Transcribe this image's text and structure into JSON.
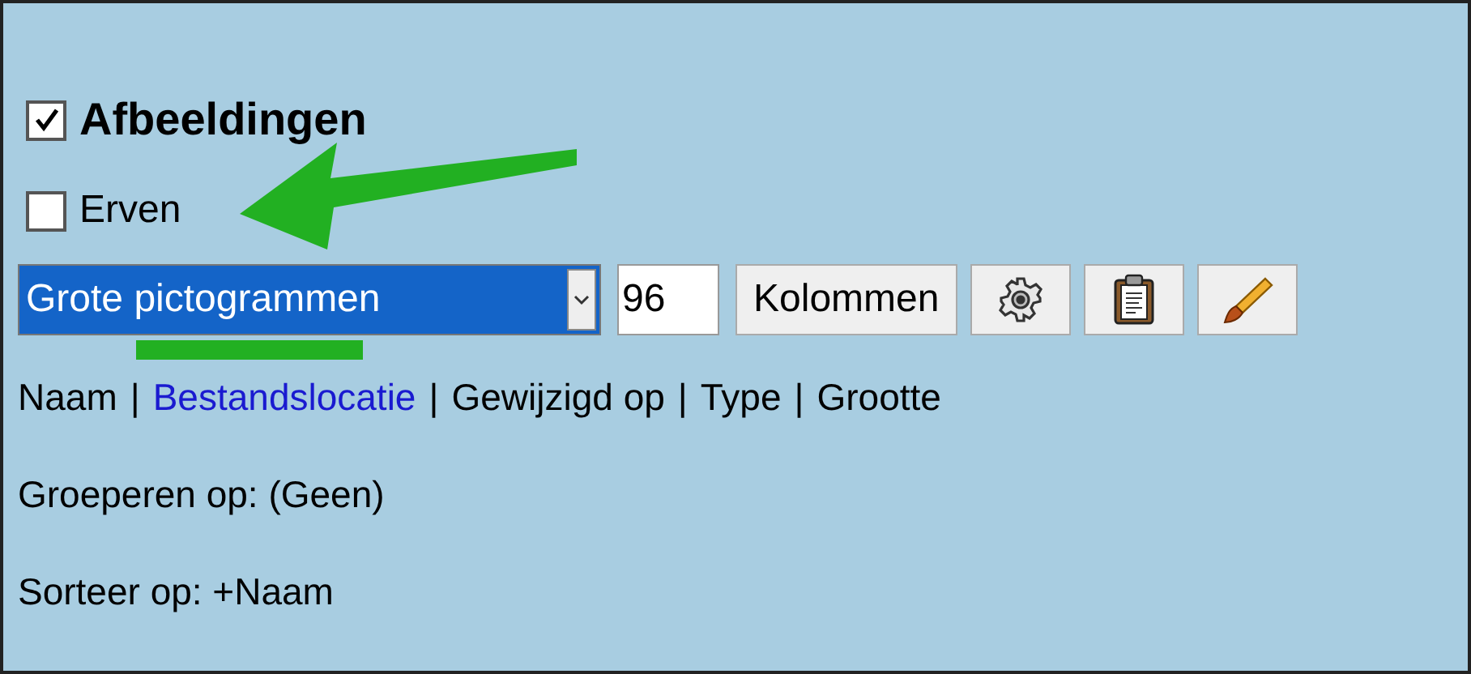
{
  "header": {
    "label": "Afbeeldingen",
    "checked": true
  },
  "inherit": {
    "label": "Erven",
    "checked": false
  },
  "toolbar": {
    "view_select": {
      "value": "Grote pictogrammen"
    },
    "size_field": {
      "value": "96"
    },
    "columns_button": "Kolommen"
  },
  "columns_line": [
    {
      "kind": "column",
      "text": "Naam",
      "selected": false
    },
    {
      "kind": "separator",
      "text": "|"
    },
    {
      "kind": "column",
      "text": "Bestandslocatie",
      "selected": true
    },
    {
      "kind": "separator",
      "text": "|"
    },
    {
      "kind": "column",
      "text": "Gewijzigd op",
      "selected": false
    },
    {
      "kind": "separator",
      "text": "|"
    },
    {
      "kind": "column",
      "text": "Type",
      "selected": false
    },
    {
      "kind": "separator",
      "text": "|"
    },
    {
      "kind": "column",
      "text": "Grootte",
      "selected": false
    }
  ],
  "group_by": "Groeperen op: (Geen)",
  "sort_by": "Sorteer op: +Naam"
}
